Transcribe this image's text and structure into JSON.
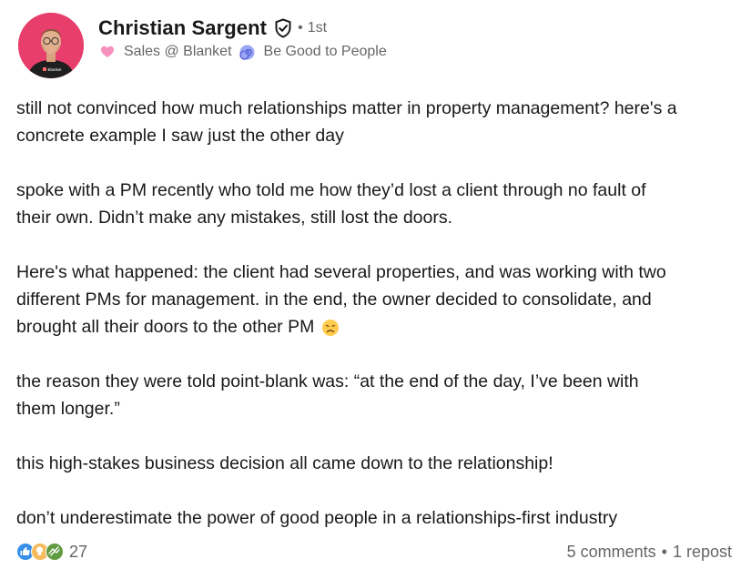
{
  "author": {
    "name": "Christian Sargent",
    "connection_separator": "•",
    "connection_degree": "1st",
    "headline_part1": "Sales @ Blanket",
    "headline_part2": "Be Good to People",
    "avatar_shirt_text": "Blanket",
    "avatar_bg_color": "#e83e6b"
  },
  "post": {
    "paragraphs": [
      {
        "lines": [
          "still not convinced how much relationships matter in property management? here's a",
          "concrete example I saw just the other day"
        ]
      },
      {
        "lines": [
          "spoke with a PM recently who told me how they’d lost a client through no fault of",
          "their own. Didn’t make any mistakes, still lost the doors."
        ]
      },
      {
        "lines": [
          "Here's what happened: the client had several properties, and was working with two",
          "different PMs for management. in the end, the owner decided to consolidate, and",
          "brought all their doors to the other PM"
        ]
      },
      {
        "lines": [
          "the reason they were told point-blank was: “at the end of the day, I’ve been with",
          "them longer.”"
        ]
      },
      {
        "lines": [
          "this high-stakes business decision all came down to the relationship!"
        ]
      },
      {
        "lines": [
          "don’t underestimate the power of good people in a relationships-first industry"
        ]
      }
    ]
  },
  "social": {
    "reaction_count": "27",
    "comments": "5 comments",
    "separator": "•",
    "reposts": "1 repost"
  },
  "icons": {
    "verified": "shield-check-icon",
    "heart": "pink-heart-emoji",
    "spiral": "spiral-emoji",
    "sad": "disappointed-face-emoji",
    "reactions": [
      "like-reaction-icon",
      "insightful-reaction-icon",
      "support-reaction-icon"
    ]
  }
}
